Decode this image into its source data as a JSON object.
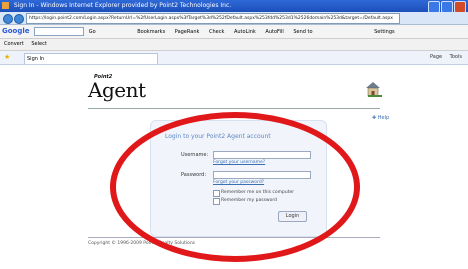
{
  "window": {
    "title": "Sign In - Windows Internet Explorer provided by Point2 Technologies Inc."
  },
  "address_bar": {
    "url": "https://login.point2.com/Login.aspx?ReturnUrl=%2fUserLogin.aspx%3fTarget%3d%252fDefault.aspx%253fdd%253d1%2526domain%253d&target=/Default.aspx"
  },
  "google_toolbar": {
    "label": "Google",
    "go_label": "Go",
    "items": [
      "Bookmarks",
      "PageRank",
      "Check",
      "AutoLink",
      "AutoFill",
      "Send to",
      "Settings"
    ]
  },
  "favorites_bar": {
    "items": [
      "Convert",
      "Select"
    ]
  },
  "tab": {
    "label": "Sign In"
  },
  "command_bar": {
    "items": [
      "Page",
      "Tools"
    ]
  },
  "brand": {
    "point2": "Point2",
    "agent": "Agent"
  },
  "help": {
    "label": "Help"
  },
  "login": {
    "heading": "Login to your Point2 Agent account",
    "username_label": "Username:",
    "username_value": "",
    "forgot_username": "Forgot your username?",
    "password_label": "Password:",
    "password_value": "",
    "forgot_password": "Forgot your password?",
    "remember_computer": "Remember me on this computer",
    "remember_password": "Remember my password",
    "login_button": "Login"
  },
  "footer": {
    "copyright": "Copyright © 1996-2009 Point2 Realty Solutions"
  },
  "colors": {
    "annotation": "#e1181a",
    "heading": "#5d86c4",
    "titlebar": "#2f69d8"
  }
}
